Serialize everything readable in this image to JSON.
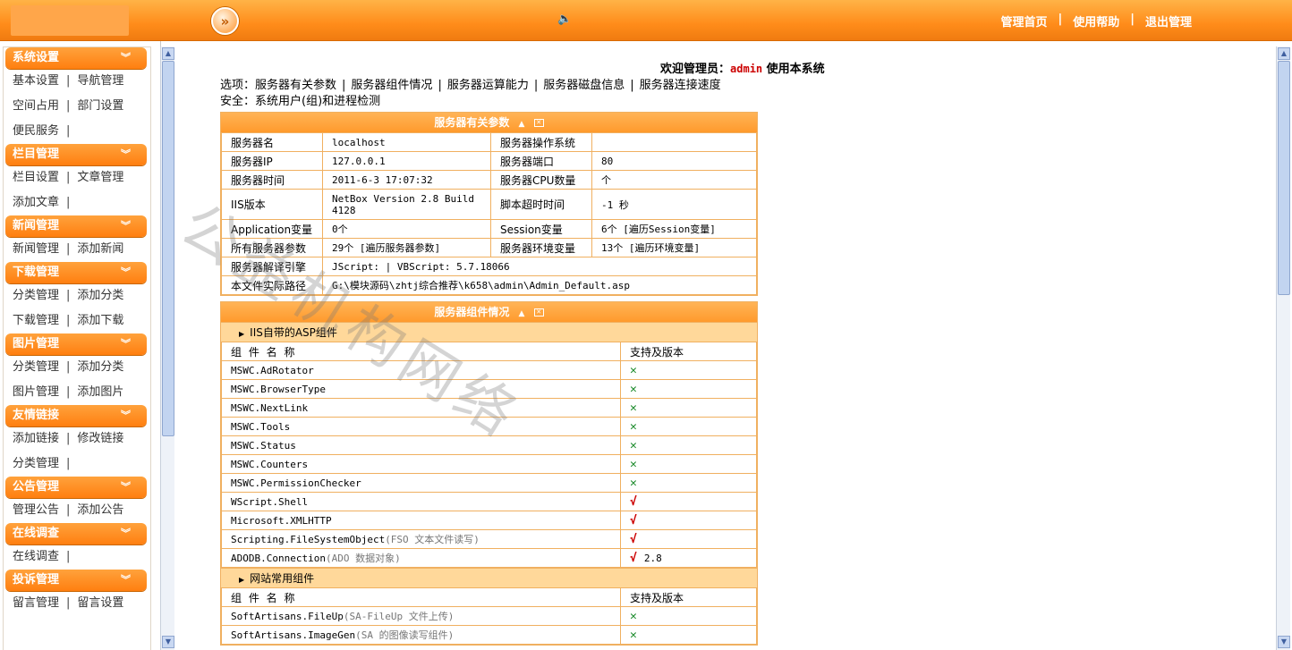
{
  "top": {
    "circle_icon": "double-chevron-right-icon",
    "links": [
      "管理首页",
      "使用帮助",
      "退出管理"
    ],
    "separator": "|"
  },
  "menu": [
    {
      "title": "系统设置",
      "rows": [
        [
          "基本设置",
          "导航管理"
        ],
        [
          "空间占用",
          "部门设置"
        ],
        [
          "便民服务",
          ""
        ]
      ]
    },
    {
      "title": "栏目管理",
      "rows": [
        [
          "栏目设置",
          "文章管理"
        ],
        [
          "添加文章",
          ""
        ]
      ]
    },
    {
      "title": "新闻管理",
      "rows": [
        [
          "新闻管理",
          "添加新闻"
        ]
      ]
    },
    {
      "title": "下载管理",
      "rows": [
        [
          "分类管理",
          "添加分类"
        ],
        [
          "下载管理",
          "添加下载"
        ]
      ]
    },
    {
      "title": "图片管理",
      "rows": [
        [
          "分类管理",
          "添加分类"
        ],
        [
          "图片管理",
          "添加图片"
        ]
      ]
    },
    {
      "title": "友情链接",
      "rows": [
        [
          "添加链接",
          "修改链接"
        ],
        [
          "分类管理",
          ""
        ]
      ]
    },
    {
      "title": "公告管理",
      "rows": [
        [
          "管理公告",
          "添加公告"
        ]
      ]
    },
    {
      "title": "在线调查",
      "rows": [
        [
          "在线调查",
          ""
        ]
      ]
    },
    {
      "title": "投诉管理",
      "rows": [
        [
          "留言管理",
          "留言设置"
        ]
      ]
    }
  ],
  "welcome": {
    "prefix": "欢迎管理员：",
    "user": "admin",
    "suffix": " 使用本系统"
  },
  "options": {
    "label": "选项：",
    "items": [
      "服务器有关参数",
      "服务器组件情况",
      "服务器运算能力",
      "服务器磁盘信息",
      "服务器连接速度"
    ]
  },
  "safety": "安全：系统用户(组)和进程检测",
  "params_panel": {
    "title": "服务器有关参数",
    "rows": [
      [
        "服务器名",
        "localhost",
        "服务器操作系统",
        ""
      ],
      [
        "服务器IP",
        "127.0.0.1",
        "服务器端口",
        "80"
      ],
      [
        "服务器时间",
        "2011-6-3 17:07:32",
        "服务器CPU数量",
        "个"
      ],
      [
        "IIS版本",
        "NetBox Version 2.8 Build 4128",
        "脚本超时时间",
        "-1 秒"
      ],
      [
        "Application变量",
        "0个",
        "Session变量",
        "6个 [遍历Session变量]"
      ],
      [
        "所有服务器参数",
        "29个 [遍历服务器参数]",
        "服务器环境变量",
        "13个 [遍历环境变量]"
      ]
    ],
    "engine_label": "服务器解译引擎",
    "engine_value": "JScript: | VBScript: 5.7.18066",
    "path_label": "本文件实际路径",
    "path_value": "G:\\模块源码\\zhtj综合推荐\\k658\\admin\\Admin_Default.asp"
  },
  "comps_panel": {
    "title": "服务器组件情况",
    "group1": "IIS自带的ASP组件",
    "col1": "组 件 名 称",
    "col2": "支持及版本",
    "items1": [
      {
        "name": "MSWC.AdRotator",
        "note": "",
        "status": "✕",
        "ver": ""
      },
      {
        "name": "MSWC.BrowserType",
        "note": "",
        "status": "✕",
        "ver": ""
      },
      {
        "name": "MSWC.NextLink",
        "note": "",
        "status": "✕",
        "ver": ""
      },
      {
        "name": "MSWC.Tools",
        "note": "",
        "status": "✕",
        "ver": ""
      },
      {
        "name": "MSWC.Status",
        "note": "",
        "status": "✕",
        "ver": ""
      },
      {
        "name": "MSWC.Counters",
        "note": "",
        "status": "✕",
        "ver": ""
      },
      {
        "name": "MSWC.PermissionChecker",
        "note": "",
        "status": "✕",
        "ver": ""
      },
      {
        "name": "WScript.Shell",
        "note": "",
        "status": "√",
        "ver": ""
      },
      {
        "name": "Microsoft.XMLHTTP",
        "note": "",
        "status": "√",
        "ver": ""
      },
      {
        "name": "Scripting.FileSystemObject",
        "note": "(FSO 文本文件读写)",
        "status": "√",
        "ver": ""
      },
      {
        "name": "ADODB.Connection",
        "note": "(ADO 数据对象)",
        "status": "√",
        "ver": "2.8"
      }
    ],
    "group2": "网站常用组件",
    "items2": [
      {
        "name": "SoftArtisans.FileUp",
        "note": "(SA-FileUp 文件上传)",
        "status": "✕",
        "ver": ""
      },
      {
        "name": "SoftArtisans.ImageGen",
        "note": "(SA 的图像读写组件)",
        "status": "✕",
        "ver": ""
      }
    ]
  },
  "watermark": "公益机构网络"
}
